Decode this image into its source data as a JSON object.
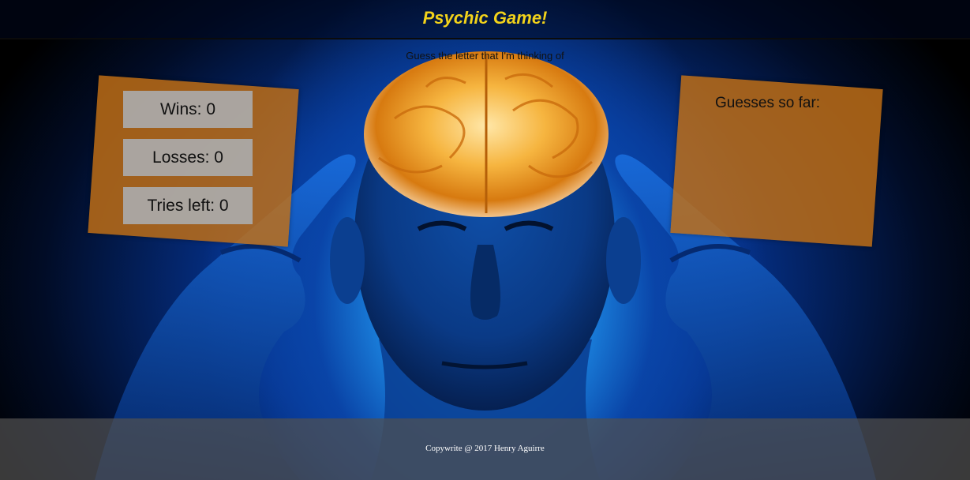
{
  "header": {
    "title": "Psychic Game!",
    "subtitle": "Guess the letter that I'm thinking of"
  },
  "stats": {
    "wins": "Wins: 0",
    "losses": "Losses: 0",
    "tries_left": "Tries left: 0"
  },
  "guesses": {
    "label": "Guesses so far:",
    "letters": ""
  },
  "footer": {
    "copyright": "Copywrite @ 2017 Henry Aguirre"
  },
  "colors": {
    "title": "#f2d21a",
    "panel": "#c47014",
    "stat_box": "#aaaaaa",
    "footer": "#505050"
  },
  "icons": {
    "background": "glowing-brain-head-image"
  }
}
